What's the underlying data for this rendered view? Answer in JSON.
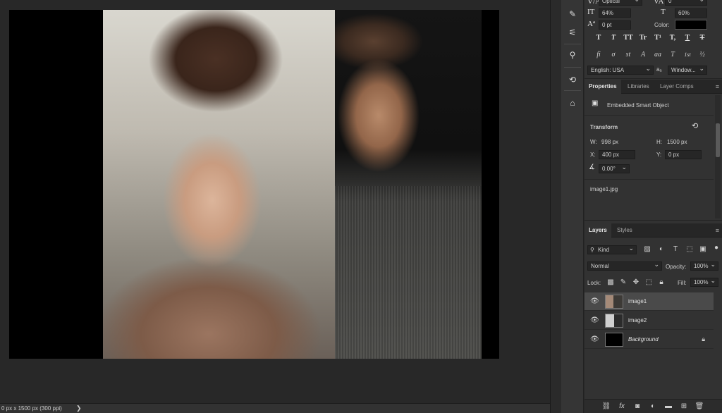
{
  "status": {
    "text": "0 px x 1500 px (300 ppi)",
    "arrow": "❯"
  },
  "character": {
    "font_style": "Optical",
    "tracking": "0",
    "vertical_scale": "64%",
    "horizontal_scale": "60%",
    "baseline_shift": "0 pt",
    "color_label": "Color:",
    "color_value": "#000000",
    "type_buttons": [
      "T",
      "T",
      "TT",
      "Tr",
      "T¹",
      "T,",
      "T",
      "T"
    ],
    "opentype_buttons": [
      "fi",
      "σ",
      "st",
      "A",
      "aa",
      "T",
      "1st",
      "½"
    ],
    "language": "English: USA",
    "aa_label": "aₐ",
    "antialias": "Window..."
  },
  "properties": {
    "tabs": [
      "Properties",
      "Libraries",
      "Layer Comps"
    ],
    "active_tab": "Properties",
    "kind": "Embedded Smart Object",
    "transform_label": "Transform",
    "w_label": "W:",
    "w_value": "998 px",
    "h_label": "H:",
    "h_value": "1500 px",
    "x_label": "X:",
    "x_value": "400 px",
    "y_label": "Y:",
    "y_value": "0 px",
    "angle": "0.00°",
    "file": "image1.jpg"
  },
  "layers": {
    "tabs": [
      "Layers",
      "Styles"
    ],
    "active_tab": "Layers",
    "filter": "Kind",
    "blend_mode": "Normal",
    "opacity_label": "Opacity:",
    "opacity": "100%",
    "lock_label": "Lock:",
    "fill_label": "Fill:",
    "fill": "100%",
    "items": [
      {
        "name": "image1",
        "selected": true,
        "italic": false,
        "locked": false
      },
      {
        "name": "image2",
        "selected": false,
        "italic": false,
        "locked": false
      },
      {
        "name": "Background",
        "selected": false,
        "italic": true,
        "locked": true
      }
    ]
  },
  "colors": {
    "panel": "#323232",
    "canvas": "#282828",
    "selected_row": "#4a4a4a"
  }
}
